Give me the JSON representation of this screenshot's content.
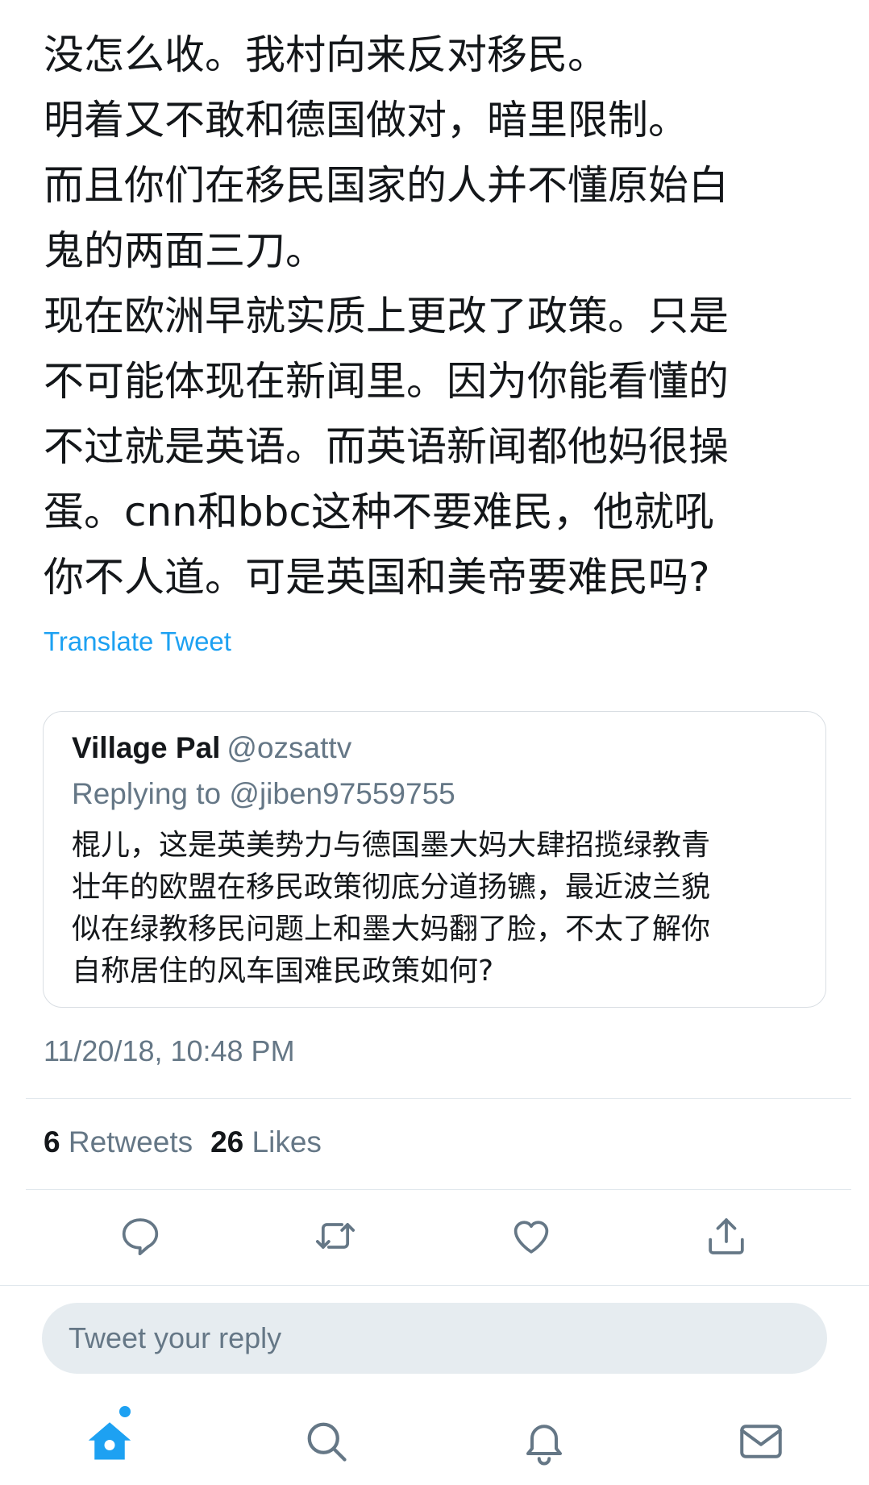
{
  "tweet": {
    "lines": [
      "没怎么收。我村向来反对移民。",
      "明着又不敢和德国做对，暗里限制。",
      "而且你们在移民国家的人并不懂原始白",
      "鬼的两面三刀。",
      "现在欧洲早就实质上更改了政策。只是",
      "不可能体现在新闻里。因为你能看懂的",
      "不过就是英语。而英语新闻都他妈很操",
      "蛋。cnn和bbc这种不要难民，他就吼",
      "你不人道。可是英国和美帝要难民吗?"
    ],
    "translate_label": "Translate Tweet"
  },
  "quoted_tweet": {
    "name": "Village Pal",
    "handle": "@ozsattv",
    "replying_to": "Replying to @jiben97559755",
    "lines": [
      "棍儿，这是英美势力与德国墨大妈大肆招揽绿教青",
      "壮年的欧盟在移民政策彻底分道扬镳，最近波兰貌",
      "似在绿教移民问题上和墨大妈翻了脸，不太了解你",
      "自称居住的风车国难民政策如何?"
    ]
  },
  "timestamp": "11/20/18, 10:48 PM",
  "stats": {
    "retweets_count": "6",
    "retweets_label": "Retweets",
    "likes_count": "26",
    "likes_label": "Likes"
  },
  "actions": {
    "icons": [
      "reply-icon",
      "retweet-icon",
      "like-icon",
      "share-icon"
    ]
  },
  "reply": {
    "placeholder": "Tweet your reply"
  },
  "bottom_nav": {
    "icons": [
      "home-icon",
      "search-icon",
      "notifications-icon",
      "messages-icon"
    ]
  },
  "colors": {
    "accent": "#1da1f2",
    "text": "#14171a",
    "secondary_text": "#657786",
    "divider": "#e1e8ed",
    "reply_box_bg": "#e6ecf0",
    "icon_gray": "#657786"
  }
}
